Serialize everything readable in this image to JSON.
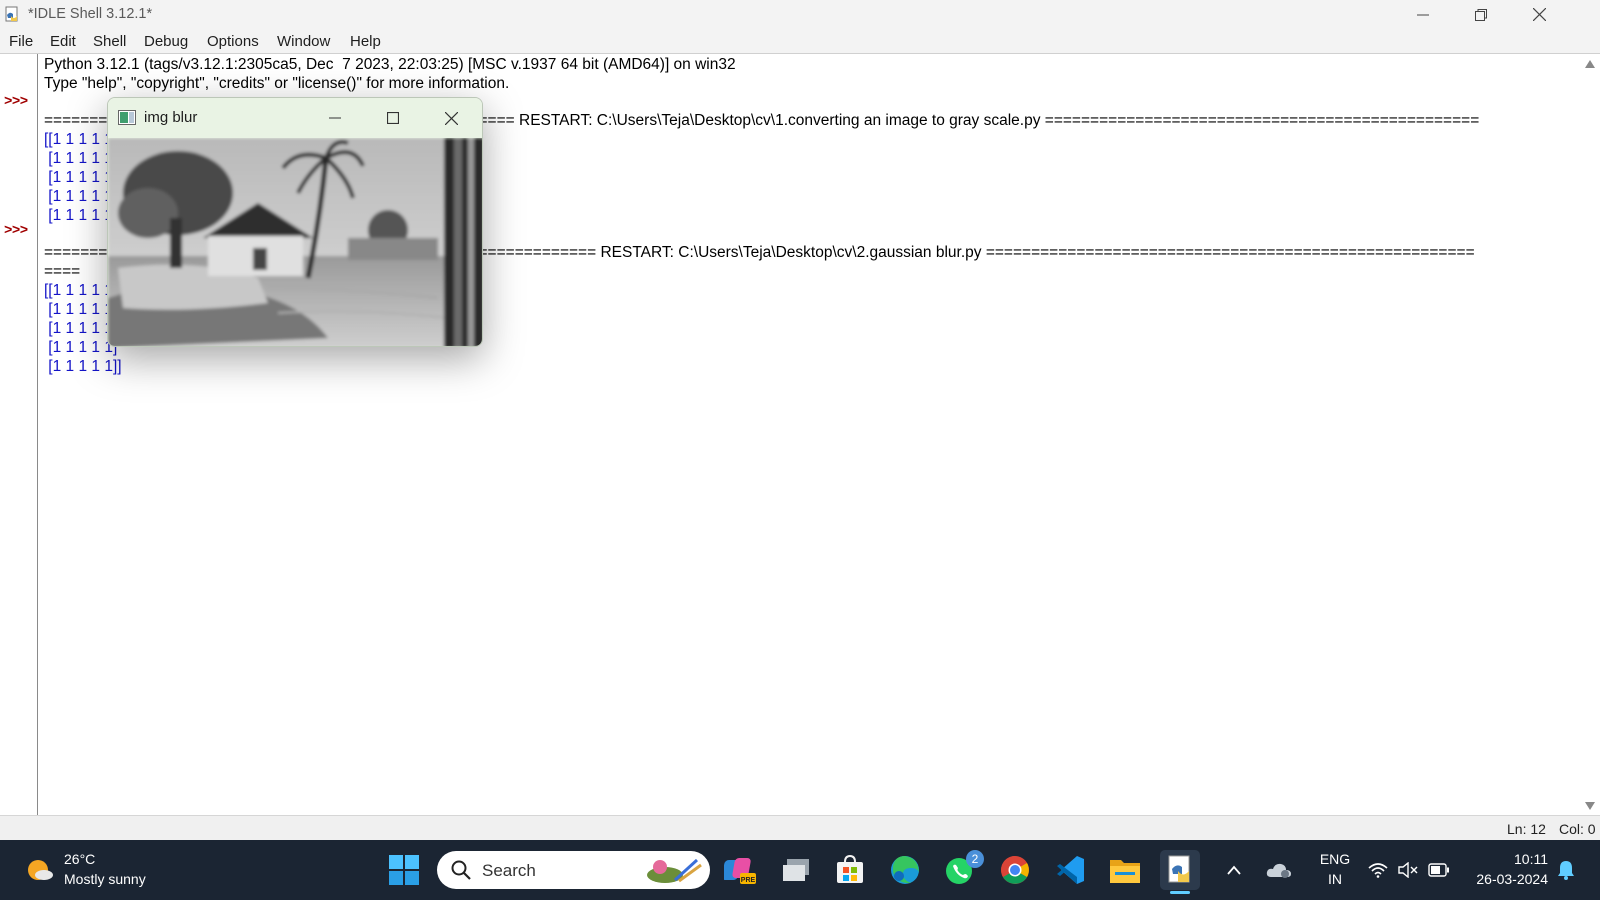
{
  "window": {
    "title": "*IDLE Shell 3.12.1*",
    "menus": [
      "File",
      "Edit",
      "Shell",
      "Debug",
      "Options",
      "Window",
      "Help"
    ]
  },
  "shell": {
    "prompt": ">>>",
    "banner_line1": "Python 3.12.1 (tags/v3.12.1:2305ca5, Dec  7 2023, 22:03:25) [MSC v.1937 64 bit (AMD64)] on win32",
    "banner_line2": "Type \"help\", \"copyright\", \"credits\" or \"license()\" for more information.",
    "restart1": "==================================================== RESTART: C:\\Users\\Teja\\Desktop\\cv\\1.converting an image to gray scale.py ================================================",
    "output1": [
      "[[1 1 1 1 1]",
      " [1 1 1 1 1]",
      " [1 1 1 1 1]",
      " [1 1 1 1 1]",
      " [1 1 1 1 1]]"
    ],
    "restart2": "============================================================= RESTART: C:\\Users\\Teja\\Desktop\\cv\\2.gaussian blur.py ======================================================",
    "restart2_wrap": "====",
    "output2": [
      "[[1 1 1 1 1]",
      " [1 1 1 1 1]",
      " [1 1 1 1 1]",
      " [1 1 1 1 1]",
      " [1 1 1 1 1]]"
    ]
  },
  "status": {
    "line": "Ln: 12",
    "col": "Col: 0"
  },
  "image_window": {
    "title": "img blur"
  },
  "taskbar": {
    "weather_temp": "26°C",
    "weather_desc": "Mostly sunny",
    "search_label": "Search",
    "whatsapp_badge": "2",
    "language": "ENG",
    "region": "IN",
    "time": "10:11",
    "date": "26-03-2024",
    "icons": [
      "start-icon",
      "search-icon",
      "copilot-icon",
      "task-view-icon",
      "store-icon",
      "edge-icon",
      "whatsapp-icon",
      "chrome-icon",
      "vscode-icon",
      "file-explorer-icon",
      "idle-icon"
    ]
  },
  "colors": {
    "taskbar": "#1b2533",
    "prompt": "#a00000",
    "output": "#1313c8",
    "image_title": "#e9f3e4"
  }
}
